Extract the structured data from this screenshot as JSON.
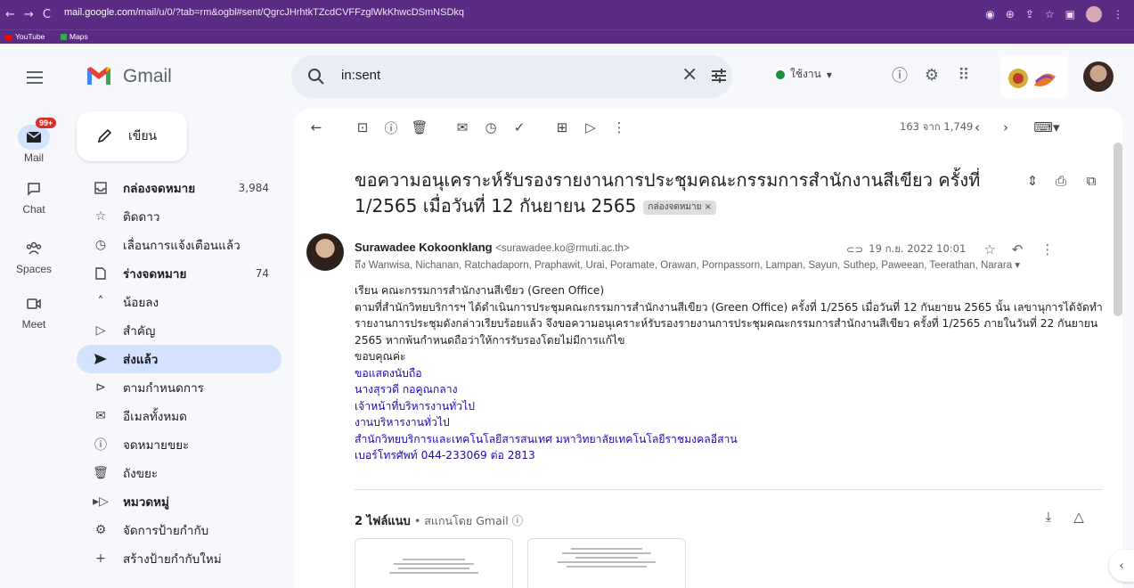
{
  "browser": {
    "url_host": "mail.google.com",
    "url_path": "/mail/u/0/?tab=rm&ogbl#sent/QgrcJHrhtkTZcdCVFFzglWkKhwcDSmNSDkq",
    "bookmarks": [
      "YouTube",
      "Maps"
    ]
  },
  "header": {
    "app_name": "Gmail",
    "search_value": "in:sent",
    "status_label": "ใช้งาน"
  },
  "rail": {
    "mail_label": "Mail",
    "mail_badge": "99+",
    "chat_label": "Chat",
    "spaces_label": "Spaces",
    "meet_label": "Meet"
  },
  "compose": {
    "label": "เขียน"
  },
  "nav": {
    "items": [
      {
        "label": "กล่องจดหมาย",
        "count": "3,984"
      },
      {
        "label": "ติดดาว",
        "count": ""
      },
      {
        "label": "เลื่อนการแจ้งเตือนแล้ว",
        "count": ""
      },
      {
        "label": "ร่างจดหมาย",
        "count": "74"
      },
      {
        "label": "น้อยลง",
        "count": ""
      },
      {
        "label": "สำคัญ",
        "count": ""
      },
      {
        "label": "ส่งแล้ว",
        "count": ""
      },
      {
        "label": "ตามกำหนดการ",
        "count": ""
      },
      {
        "label": "อีเมลทั้งหมด",
        "count": ""
      },
      {
        "label": "จดหมายขยะ",
        "count": ""
      },
      {
        "label": "ถังขยะ",
        "count": ""
      },
      {
        "label": "หมวดหมู่",
        "count": ""
      },
      {
        "label": "จัดการป้ายกำกับ",
        "count": ""
      },
      {
        "label": "สร้างป้ายกำกับใหม่",
        "count": ""
      }
    ]
  },
  "toolbar": {
    "pager": "163 จาก 1,749"
  },
  "email": {
    "subject": "ขอความอนุเคราะห์รับรองรายงานการประชุมคณะกรรมการสำนักงานสีเขียว ครั้งที่ 1/2565 เมื่อวันที่ 12 กันยายน 2565",
    "label_chip": "กล่องจดหมาย ×",
    "sender_name": "Surawadee Kokoonklang",
    "sender_email": "<surawadee.ko@rmuti.ac.th>",
    "recipients": "ถึง Wanwisa, Nichanan, Ratchadaporn, Praphawit, Urai, Poramate, Orawan, Pornpassorn, Lampan, Sayun, Suthep, Paweean, Teerathan, Narara ▾",
    "date": "19 ก.ย. 2022 10:01",
    "body": [
      "เรียน คณะกรรมการสำนักงานสีเขียว (Green Office)",
      "ตามที่สำนักวิทยบริการฯ ได้ดำเนินการประชุมคณะกรรมการสำนักงานสีเขียว (Green Office) ครั้งที่ 1/2565 เมื่อวันที่ 12 กันยายน 2565 นั้น เลขานุการได้จัดทำ",
      "รายงานการประชุมดังกล่าวเรียบร้อยแล้ว จึงขอความอนุเคราะห์รับรองรายงานการประชุมคณะกรรมการสำนักงานสีเขียว ครั้งที่ 1/2565 ภายในวันที่ 22 กันยายน",
      "2565 หากพ้นกำหนดถือว่าให้การรับรองโดยไม่มีการแก้ไข",
      "ขอบคุณค่ะ"
    ],
    "signature": [
      "ขอแสดงนับถือ",
      "นางสุรวดี  กอคูณกลาง",
      "เจ้าหน้าที่บริหารงานทั่วไป",
      "งานบริหารงานทั่วไป",
      "สำนักวิทยบริการและเทคโนโลยีสารสนเทศ มหาวิทยาลัยเทคโนโลยีราชมงคลอีสาน",
      "เบอร์โทรศัพท์ 044-233069 ต่อ 2813"
    ],
    "attachments_title": "2 ไฟล์แนบ",
    "attachments_scan": "• สแกนโดย Gmail ⓘ"
  },
  "colors": {
    "chrome": "#5b2c83",
    "background": "#f6f8fc",
    "active_nav": "#d3e3fd",
    "signature_link": "#1a0dab",
    "badge": "#d93025"
  }
}
